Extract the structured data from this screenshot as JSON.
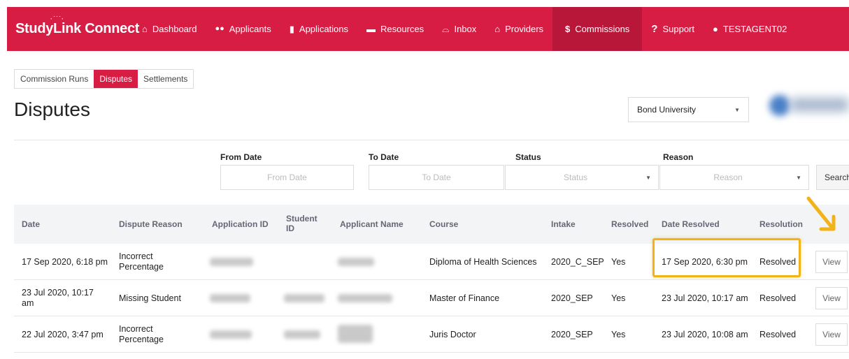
{
  "brand": {
    "name": "StudyLink Connect"
  },
  "nav": {
    "items": [
      {
        "label": "Dashboard",
        "icon": "home-icon",
        "glyph": "⌂",
        "active": false
      },
      {
        "label": "Applicants",
        "icon": "users-icon",
        "glyph": "👥",
        "active": false
      },
      {
        "label": "Applications",
        "icon": "document-icon",
        "glyph": "▆",
        "active": false
      },
      {
        "label": "Resources",
        "icon": "folder-icon",
        "glyph": "▬",
        "active": false
      },
      {
        "label": "Inbox",
        "icon": "inbox-icon",
        "glyph": "⌓",
        "active": false
      },
      {
        "label": "Providers",
        "icon": "institution-icon",
        "glyph": "⏛",
        "active": false
      },
      {
        "label": "Commissions",
        "icon": "dollar-icon",
        "glyph": "$",
        "active": true
      },
      {
        "label": "Support",
        "icon": "question-icon",
        "glyph": "?",
        "active": false
      },
      {
        "label": "TESTAGENT02",
        "icon": "user-icon",
        "glyph": "👤",
        "active": false
      }
    ]
  },
  "subtabs": [
    {
      "label": "Commission Runs",
      "active": false
    },
    {
      "label": "Disputes",
      "active": true
    },
    {
      "label": "Settlements",
      "active": false
    }
  ],
  "page": {
    "title": "Disputes"
  },
  "university_select": {
    "value": "Bond University"
  },
  "filters": {
    "from_date": {
      "label": "From Date",
      "placeholder": "From Date"
    },
    "to_date": {
      "label": "To Date",
      "placeholder": "To Date"
    },
    "status": {
      "label": "Status",
      "placeholder": "Status"
    },
    "reason": {
      "label": "Reason",
      "placeholder": "Reason"
    },
    "search_label": "Search"
  },
  "table": {
    "headers": {
      "date": "Date",
      "dispute_reason": "Dispute Reason",
      "application_id": "Application ID",
      "student_id": "Student ID",
      "applicant_name": "Applicant Name",
      "course": "Course",
      "intake": "Intake",
      "resolved": "Resolved",
      "date_resolved": "Date Resolved",
      "resolution": "Resolution"
    },
    "rows": [
      {
        "date": "17 Sep 2020, 6:18 pm",
        "dispute_reason": "Incorrect Percentage",
        "course": "Diploma of Health Sciences",
        "intake": "2020_C_SEP",
        "resolved": "Yes",
        "date_resolved": "17 Sep 2020, 6:30 pm",
        "resolution": "Resolved",
        "action": "View"
      },
      {
        "date": "23 Jul 2020, 10:17 am",
        "dispute_reason": "Missing Student",
        "course": "Master of Finance",
        "intake": "2020_SEP",
        "resolved": "Yes",
        "date_resolved": "23 Jul 2020, 10:17 am",
        "resolution": "Resolved",
        "action": "View"
      },
      {
        "date": "22 Jul 2020, 3:47 pm",
        "dispute_reason": "Incorrect Percentage",
        "course": "Juris Doctor",
        "intake": "2020_SEP",
        "resolved": "Yes",
        "date_resolved": "23 Jul 2020, 10:08 am",
        "resolution": "Resolved",
        "action": "View"
      }
    ]
  },
  "colors": {
    "brand": "#d81d44",
    "brand_active": "#b8173a",
    "highlight": "#f2b21a"
  }
}
